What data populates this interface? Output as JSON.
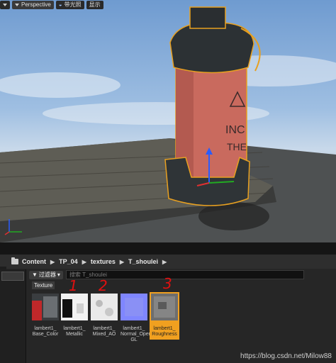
{
  "viewport": {
    "toolbar": {
      "view_mode": "Perspective",
      "lighting": "带光照",
      "show": "显示"
    },
    "prop_text": [
      "INC",
      "THE"
    ]
  },
  "browser": {
    "path": [
      "Content",
      "TP_04",
      "textures",
      "T_shoulei"
    ],
    "filter_label": "过滤器",
    "search_placeholder": "搜索 T_shoulei",
    "type_filter": "Texture",
    "assets": [
      {
        "name_line1": "lambert1_",
        "name_line2": "Base_Color",
        "name_line3": ""
      },
      {
        "name_line1": "lambert1_",
        "name_line2": "Metallic",
        "name_line3": ""
      },
      {
        "name_line1": "lambert1_",
        "name_line2": "Mixed_AO",
        "name_line3": ""
      },
      {
        "name_line1": "lambert1_",
        "name_line2": "Normal_Open",
        "name_line3": "GL"
      },
      {
        "name_line1": "lambert1_",
        "name_line2": "Roughness",
        "name_line3": ""
      }
    ],
    "annotations": [
      "1",
      "2",
      "3"
    ]
  },
  "watermark": "https://blog.csdn.net/Milow88",
  "colors": {
    "selection": "#f0a020",
    "annotation": "#e01010",
    "normal_map": "#7f86ff"
  }
}
